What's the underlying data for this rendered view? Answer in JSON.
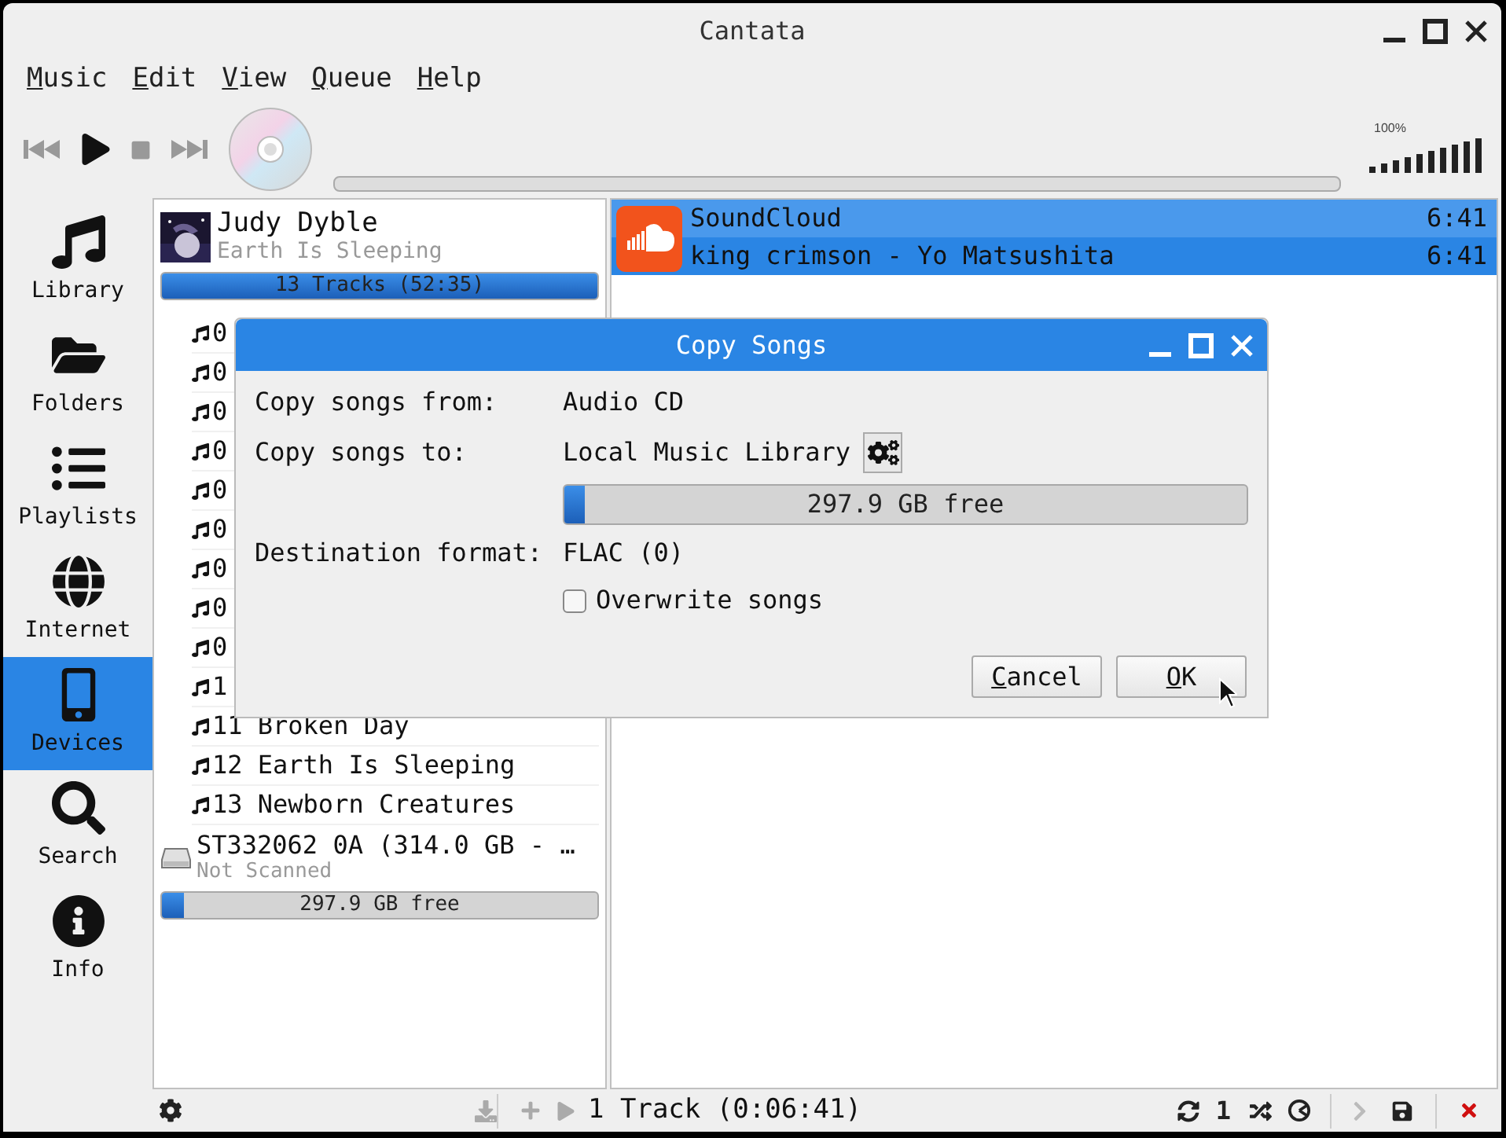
{
  "window": {
    "title": "Cantata"
  },
  "menu": [
    "Music",
    "Edit",
    "View",
    "Queue",
    "Help"
  ],
  "toolbar": {
    "position": {
      "level": 0
    },
    "volume": {
      "reading": "100%",
      "level": 1
    }
  },
  "sidebar": {
    "items": [
      {
        "label": "Library",
        "selected": false
      },
      {
        "label": "Folders",
        "selected": false
      },
      {
        "label": "Playlists",
        "selected": false
      },
      {
        "label": "Internet",
        "selected": false
      },
      {
        "label": "Devices",
        "selected": true
      },
      {
        "label": "Search",
        "selected": false
      },
      {
        "label": "Info",
        "selected": false
      }
    ]
  },
  "devices": {
    "album": {
      "artist": "Judy Dyble",
      "title": "Earth Is Sleeping"
    },
    "tracks_bar": {
      "label": "13 Tracks (52:35)",
      "level": 1
    },
    "tracks": [
      "0",
      "0",
      "0",
      "0",
      "0",
      "0",
      "0",
      "0",
      "0",
      "1",
      "11 Broken Day",
      "12 Earth Is Sleeping",
      "13 Newborn Creatures"
    ],
    "drive": {
      "name": "ST332062 0A (314.0 GB - …",
      "status": "Not Scanned"
    },
    "drive_space": {
      "label": "297.9 GB free",
      "level": 0.05
    }
  },
  "queue": {
    "group": {
      "title": "SoundCloud",
      "time": "6:41",
      "selected": true
    },
    "rows": [
      {
        "title": "king crimson - Yo Matsushita",
        "time": "6:41",
        "selected": true
      }
    ]
  },
  "dialog": {
    "title": "Copy Songs",
    "from": {
      "label": "Copy songs from:",
      "value": "Audio CD"
    },
    "to": {
      "label": "Copy songs to:",
      "value": "Local Music Library"
    },
    "space": {
      "label": "297.9 GB free",
      "level": 0.03
    },
    "format": {
      "label": "Destination format:",
      "value": "FLAC (0)"
    },
    "overwrite": {
      "label": "Overwrite songs",
      "checked": false
    },
    "buttons": [
      "Cancel",
      "OK"
    ]
  },
  "status_bar": {
    "summary": "1 Track (0:06:41)",
    "single": "1"
  }
}
